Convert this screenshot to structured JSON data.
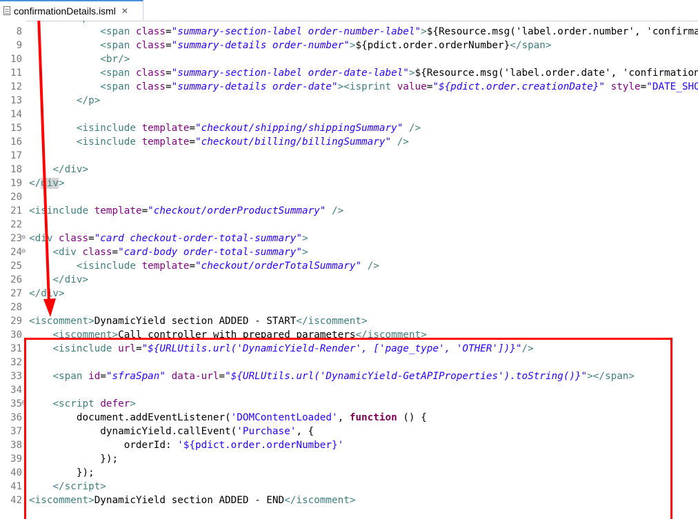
{
  "tab": {
    "label": "confirmationDetails.isml",
    "close": "✕"
  },
  "lines": [
    {
      "n": "",
      "html": "        <span class=\"tag\">&lt;p&gt;</span>"
    },
    {
      "n": "8",
      "html": "            <span class=\"tag\">&lt;span</span> <span class=\"attr\">class</span>=<span class=\"val\">\"summary-section-label order-number-label\"</span><span class=\"tag\">&gt;</span>${Resource.msg('label.order.number', 'confirmation', null)}<span class=\"tag\">&lt;/span&gt;</span>"
    },
    {
      "n": "9",
      "html": "            <span class=\"tag\">&lt;span</span> <span class=\"attr\">class</span>=<span class=\"val\">\"summary-details order-number\"</span><span class=\"tag\">&gt;</span>${pdict.order.orderNumber}<span class=\"tag\">&lt;/span&gt;</span>"
    },
    {
      "n": "10",
      "html": "            <span class=\"tag\">&lt;br/&gt;</span>"
    },
    {
      "n": "11",
      "html": "            <span class=\"tag\">&lt;span</span> <span class=\"attr\">class</span>=<span class=\"val\">\"summary-section-label order-date-label\"</span><span class=\"tag\">&gt;</span>${Resource.msg('label.order.date', 'confirmation', null)}<span class=\"tag\">&lt;/span&gt;</span>"
    },
    {
      "n": "12",
      "html": "            <span class=\"tag\">&lt;span</span> <span class=\"attr\">class</span>=<span class=\"val\">\"summary-details order-date\"</span><span class=\"tag\">&gt;&lt;isprint</span> <span class=\"attr\">value</span>=<span class=\"val\">\"${pdict.order.creationDate}\"</span> <span class=\"attr\">style</span>=<span class=\"str\">\"DATE_SHORT\"</span><span class=\"tag\">/&gt;</span>"
    },
    {
      "n": "13",
      "html": "        <span class=\"tag\">&lt;/p&gt;</span>"
    },
    {
      "n": "14",
      "html": ""
    },
    {
      "n": "15",
      "html": "        <span class=\"tag\">&lt;isinclude</span> <span class=\"attr\">template</span>=<span class=\"val\">\"checkout/shipping/shippingSummary\"</span> <span class=\"tag\">/&gt;</span>"
    },
    {
      "n": "16",
      "html": "        <span class=\"tag\">&lt;isinclude</span> <span class=\"attr\">template</span>=<span class=\"val\">\"checkout/billing/billingSummary\"</span> <span class=\"tag\">/&gt;</span>"
    },
    {
      "n": "17",
      "html": ""
    },
    {
      "n": "18",
      "html": "    <span class=\"tag\">&lt;/div&gt;</span>"
    },
    {
      "n": "19",
      "html": "<span class=\"tag\">&lt;/<span class=\"hl\">div</span>&gt;</span>"
    },
    {
      "n": "20",
      "html": ""
    },
    {
      "n": "21",
      "html": "<span class=\"tag\">&lt;isinclude</span> <span class=\"attr\">template</span>=<span class=\"val\">\"checkout/orderProductSummary\"</span> <span class=\"tag\">/&gt;</span>"
    },
    {
      "n": "22",
      "html": ""
    },
    {
      "n": "23",
      "fold": true,
      "html": "<span class=\"tag\">&lt;div</span> <span class=\"attr\">class</span>=<span class=\"val\">\"card checkout-order-total-summary\"</span><span class=\"tag\">&gt;</span>"
    },
    {
      "n": "24",
      "fold": true,
      "html": "    <span class=\"tag\">&lt;div</span> <span class=\"attr\">class</span>=<span class=\"val\">\"card-body order-total-summary\"</span><span class=\"tag\">&gt;</span>"
    },
    {
      "n": "25",
      "html": "        <span class=\"tag\">&lt;isinclude</span> <span class=\"attr\">template</span>=<span class=\"val\">\"checkout/orderTotalSummary\"</span> <span class=\"tag\">/&gt;</span>"
    },
    {
      "n": "26",
      "html": "    <span class=\"tag\">&lt;/div&gt;</span>"
    },
    {
      "n": "27",
      "html": "<span class=\"tag\">&lt;/div&gt;</span>"
    },
    {
      "n": "28",
      "html": ""
    },
    {
      "n": "29",
      "html": "<span class=\"tag\">&lt;iscomment&gt;</span>DynamicYield section ADDED - START<span class=\"tag\">&lt;/iscomment&gt;</span>"
    },
    {
      "n": "30",
      "html": "    <span class=\"tag\">&lt;iscomment&gt;</span>Call controller with prepared parameters<span class=\"tag\">&lt;/iscomment&gt;</span>"
    },
    {
      "n": "31",
      "html": "    <span class=\"tag\">&lt;isinclude</span> <span class=\"attr\">url</span>=<span class=\"val\">\"${URLUtils.url('DynamicYield-Render', ['page_type', 'OTHER'])}\"</span><span class=\"tag\">/&gt;</span>"
    },
    {
      "n": "32",
      "html": ""
    },
    {
      "n": "33",
      "html": "    <span class=\"tag\">&lt;span</span> <span class=\"attr\">id</span>=<span class=\"val\">\"sfraSpan\"</span> <span class=\"attr\">data-url</span>=<span class=\"val\">\"${URLUtils.url('DynamicYield-GetAPIProperties').toString()}\"</span><span class=\"tag\">&gt;&lt;/span&gt;</span>"
    },
    {
      "n": "34",
      "html": ""
    },
    {
      "n": "35",
      "fold": true,
      "html": "    <span class=\"tag\">&lt;script</span> <span class=\"attr\">defer</span><span class=\"tag\">&gt;</span>"
    },
    {
      "n": "36",
      "html": "        document.addEventListener(<span class=\"str\">'DOMContentLoaded'</span>, <span class=\"kw\">function</span> () {"
    },
    {
      "n": "37",
      "html": "            dynamicYield.callEvent(<span class=\"str\">'Purchase'</span>, {"
    },
    {
      "n": "38",
      "html": "                orderId: <span class=\"str\">'${pdict.order.orderNumber}'</span>"
    },
    {
      "n": "39",
      "html": "            });"
    },
    {
      "n": "40",
      "html": "        });"
    },
    {
      "n": "41",
      "html": "    <span class=\"tag\">&lt;/script&gt;</span>"
    },
    {
      "n": "42",
      "html": "<span class=\"tag\">&lt;iscomment&gt;</span>DynamicYield section ADDED - END<span class=\"tag\">&lt;/iscomment&gt;</span>"
    }
  ],
  "colors": {
    "annotation": "#ff0000",
    "tag": "#3f7f7f",
    "attr": "#7f007f",
    "value": "#2a00ff",
    "keyword": "#7f0055"
  }
}
